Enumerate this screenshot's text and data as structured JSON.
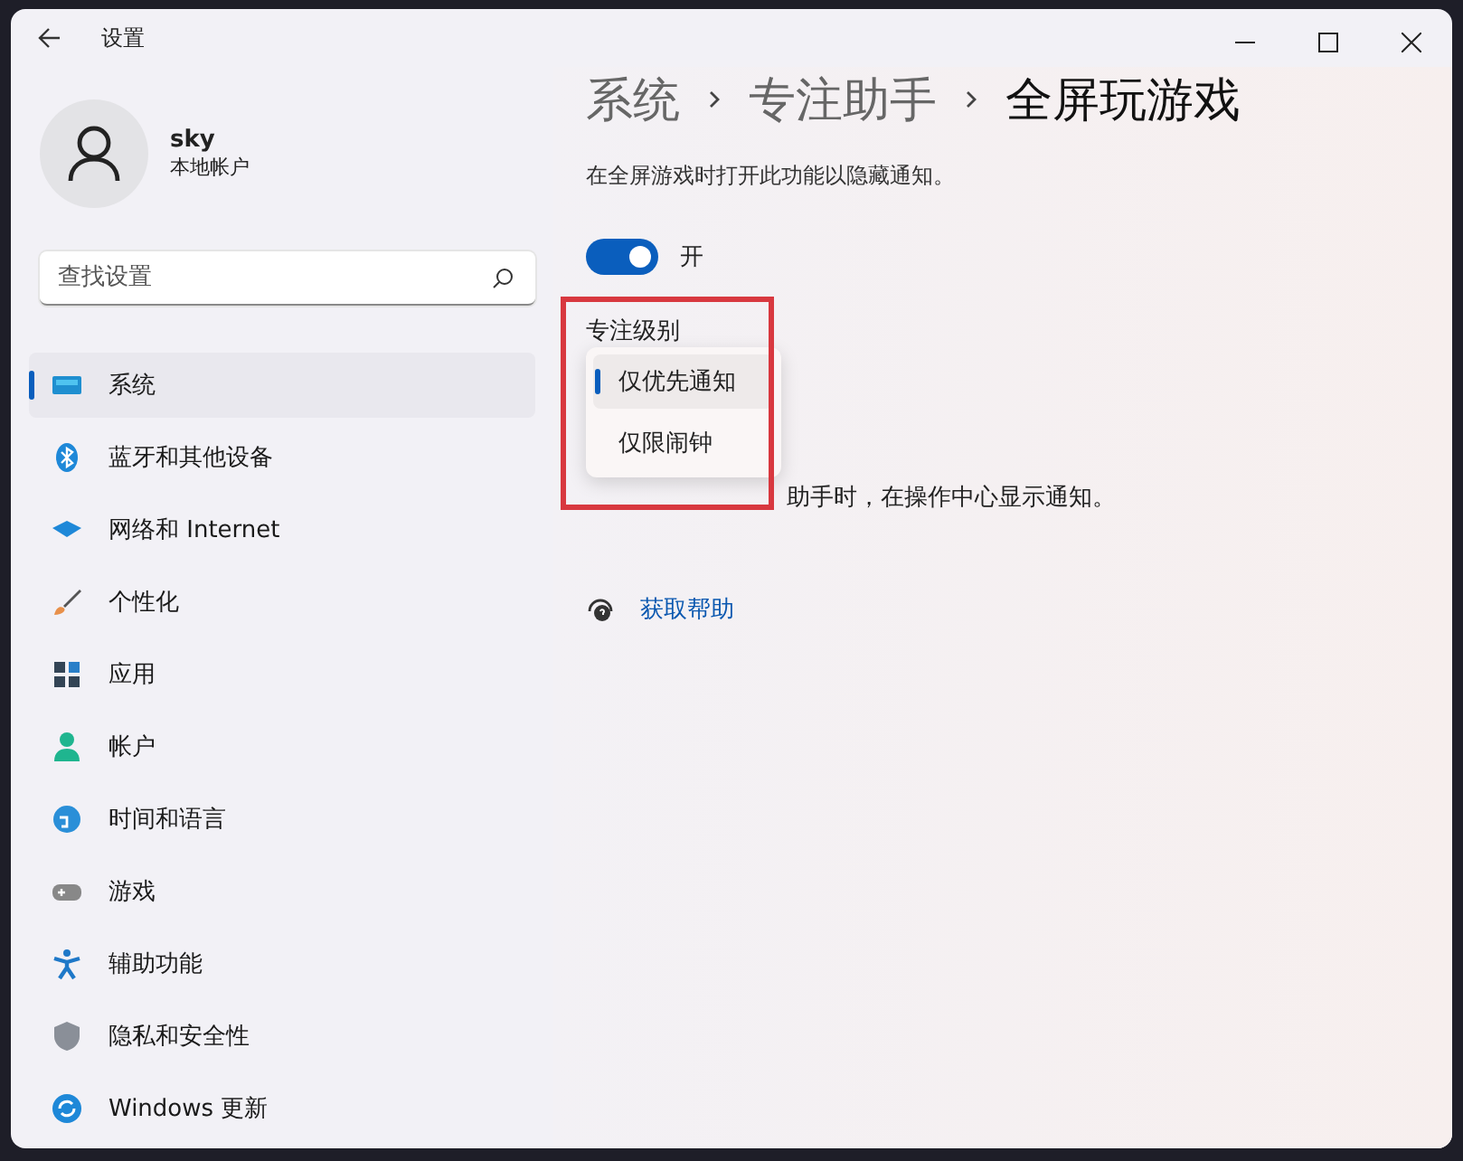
{
  "window": {
    "title": "设置"
  },
  "account": {
    "name": "sky",
    "type": "本地帐户"
  },
  "search": {
    "placeholder": "查找设置"
  },
  "sidebar": {
    "items": [
      {
        "label": "系统",
        "selected": true
      },
      {
        "label": "蓝牙和其他设备",
        "selected": false
      },
      {
        "label": "网络和 Internet",
        "selected": false
      },
      {
        "label": "个性化",
        "selected": false
      },
      {
        "label": "应用",
        "selected": false
      },
      {
        "label": "帐户",
        "selected": false
      },
      {
        "label": "时间和语言",
        "selected": false
      },
      {
        "label": "游戏",
        "selected": false
      },
      {
        "label": "辅助功能",
        "selected": false
      },
      {
        "label": "隐私和安全性",
        "selected": false
      },
      {
        "label": "Windows 更新",
        "selected": false
      }
    ]
  },
  "breadcrumb": [
    "系统",
    "专注助手",
    "全屏玩游戏"
  ],
  "description": "在全屏游戏时打开此功能以隐藏通知。",
  "toggle": {
    "on": true,
    "label": "开"
  },
  "focus_level": {
    "label": "专注级别",
    "options": [
      {
        "label": "仅优先通知",
        "selected": true
      },
      {
        "label": "仅限闹钟",
        "selected": false
      }
    ]
  },
  "notification_option": {
    "text": "助手时，在操作中心显示通知。"
  },
  "help_link": "获取帮助"
}
